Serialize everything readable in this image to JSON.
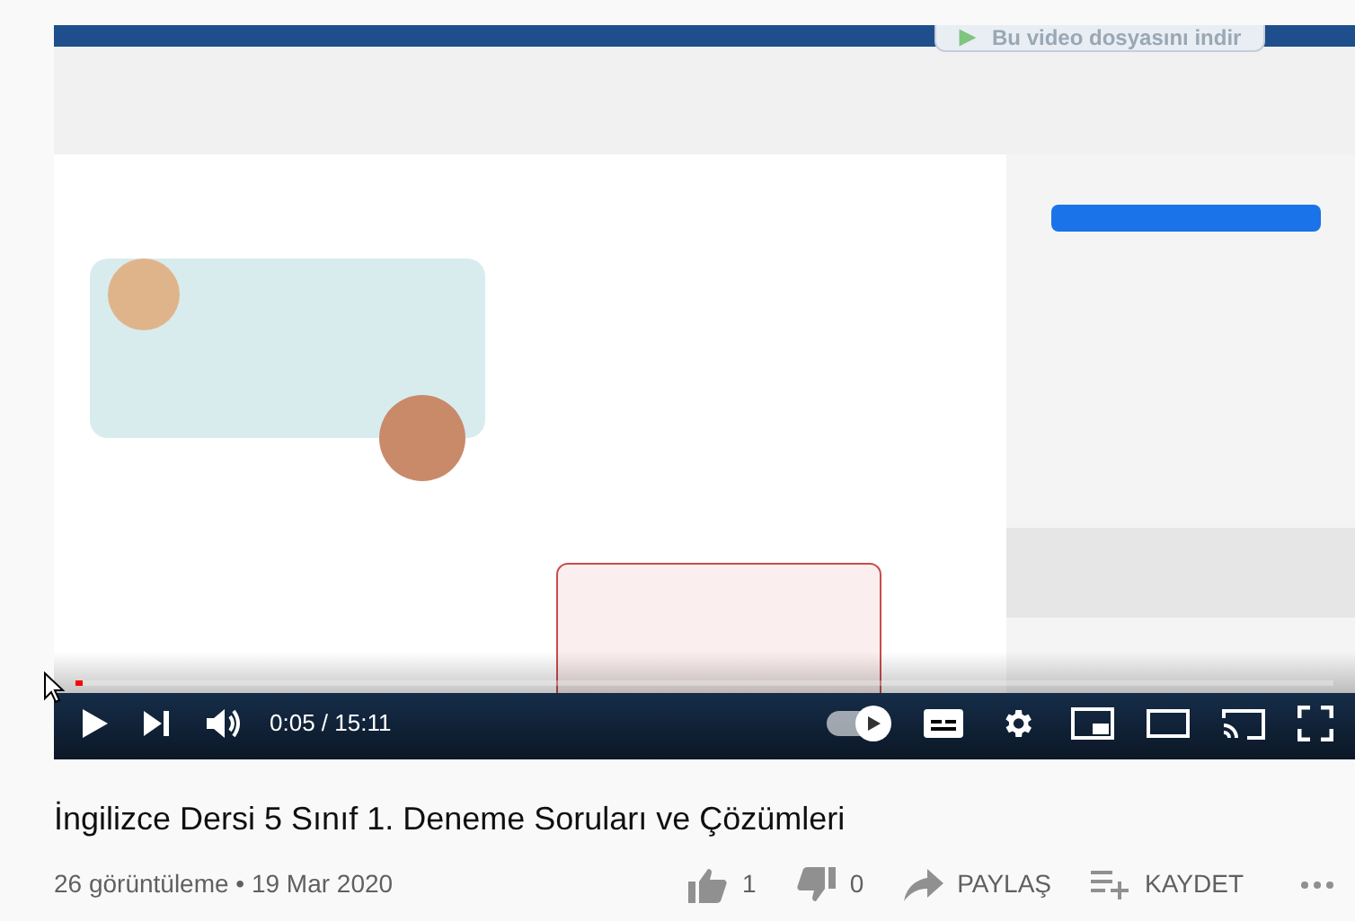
{
  "extension_button": {
    "label": "Bu video dosyasını indir"
  },
  "player": {
    "progress": {
      "level": 0.006
    },
    "time": "0:05 / 15:11",
    "autoplay": {
      "on": true
    }
  },
  "video": {
    "title": "İngilizce Dersi 5 Sınıf 1. Deneme Soruları ve Çözümleri",
    "meta": "26 görüntüleme • 19 Mar 2020"
  },
  "actions": [
    {
      "kind": "like",
      "label": "1"
    },
    {
      "kind": "dislike",
      "label": "0"
    },
    {
      "kind": "share",
      "label": "PAYLAŞ"
    },
    {
      "kind": "save",
      "label": "KAYDET"
    },
    {
      "kind": "more"
    }
  ]
}
